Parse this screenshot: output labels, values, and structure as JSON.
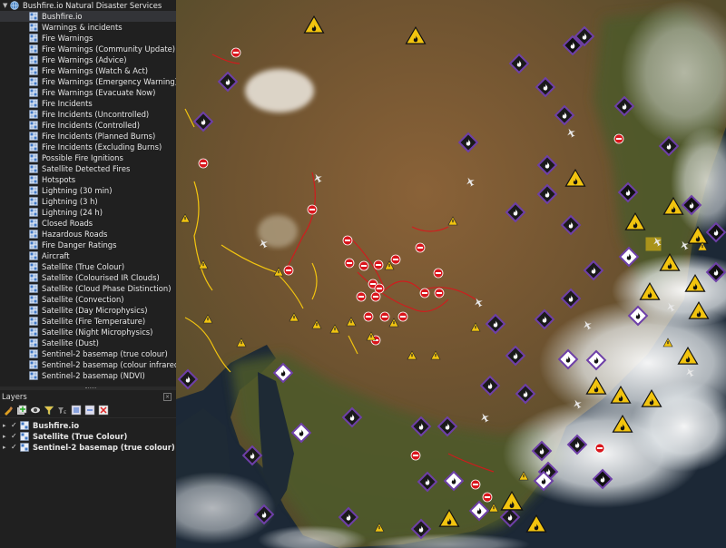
{
  "browser": {
    "root_label": "Bushfire.io Natural Disaster Services",
    "items": [
      {
        "label": "Bushfire.io",
        "selected": true
      },
      {
        "label": "Warnings & incidents"
      },
      {
        "label": "Fire Warnings"
      },
      {
        "label": "Fire Warnings (Community Update)"
      },
      {
        "label": "Fire Warnings (Advice)"
      },
      {
        "label": "Fire Warnings (Watch & Act)"
      },
      {
        "label": "Fire Warnings (Emergency Warning)"
      },
      {
        "label": "Fire Warnings (Evacuate Now)"
      },
      {
        "label": "Fire Incidents"
      },
      {
        "label": "Fire Incidents (Uncontrolled)"
      },
      {
        "label": "Fire Incidents (Controlled)"
      },
      {
        "label": "Fire Incidents (Planned Burns)"
      },
      {
        "label": "Fire Incidents (Excluding Burns)"
      },
      {
        "label": "Possible Fire Ignitions"
      },
      {
        "label": "Satellite Detected Fires"
      },
      {
        "label": "Hotspots"
      },
      {
        "label": "Lightning (30 min)"
      },
      {
        "label": "Lightning (3 h)"
      },
      {
        "label": "Lightning (24 h)"
      },
      {
        "label": "Closed Roads"
      },
      {
        "label": "Hazardous Roads"
      },
      {
        "label": "Fire Danger Ratings"
      },
      {
        "label": "Aircraft"
      },
      {
        "label": "Satellite (True Colour)"
      },
      {
        "label": "Satellite (Colourised IR Clouds)"
      },
      {
        "label": "Satellite (Cloud Phase Distinction)"
      },
      {
        "label": "Satellite (Convection)"
      },
      {
        "label": "Satellite (Day Microphysics)"
      },
      {
        "label": "Satellite (Fire Temperature)"
      },
      {
        "label": "Satellite (Night Microphysics)"
      },
      {
        "label": "Satellite (Dust)"
      },
      {
        "label": "Sentinel-2 basemap (true colour)"
      },
      {
        "label": "Sentinel-2 basemap (colour infrared)"
      },
      {
        "label": "Sentinel-2 basemap (NDVI)"
      }
    ]
  },
  "layers_panel": {
    "title": "Layers",
    "toolbar_icons": [
      "open-layer-styling-icon",
      "add-group-icon",
      "manage-map-themes-icon",
      "filter-legend-icon",
      "filter-by-expression-icon",
      "expand-all-icon",
      "collapse-all-icon",
      "remove-layer-icon"
    ],
    "layers": [
      {
        "label": "Bushfire.io",
        "checked": true
      },
      {
        "label": "Satellite (True Colour)",
        "checked": true
      },
      {
        "label": "Sentinel-2 basemap (true colour)",
        "checked": true
      }
    ]
  },
  "colors": {
    "panel_bg": "#202020",
    "text": "#e6e6e6",
    "selection": "#333438",
    "warning_yellow": "#f2c40f",
    "incident_purple": "#6e3fa8",
    "road_red": "#d9161c",
    "watch_white": "#ffffff"
  }
}
